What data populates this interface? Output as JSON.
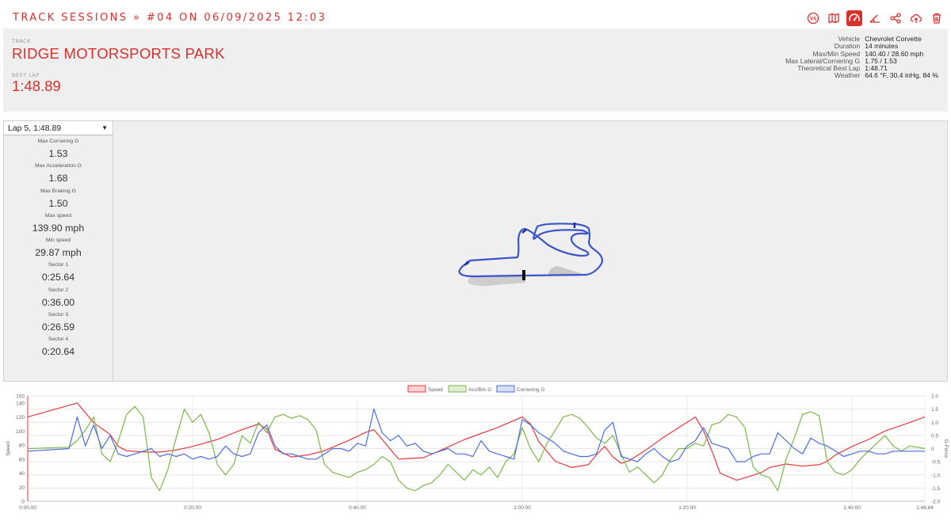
{
  "breadcrumb": "TRACK SESSIONS » #04 ON 06/09/2025 12:03",
  "actions": [
    {
      "icon": "vs-icon"
    },
    {
      "icon": "map-icon"
    },
    {
      "icon": "gauge-icon"
    },
    {
      "icon": "angle-icon"
    },
    {
      "icon": "share-icon"
    },
    {
      "icon": "cloud-upload-icon"
    },
    {
      "icon": "trash-icon"
    }
  ],
  "header": {
    "track_label": "TRACK",
    "track_name": "RIDGE MOTORSPORTS PARK",
    "best_lap_label": "BEST LAP",
    "best_lap": "1:48.89"
  },
  "stats": [
    {
      "label": "Vehicle",
      "value": "Chevrolet Corvette"
    },
    {
      "label": "Duration",
      "value": "14 minutes"
    },
    {
      "label": "Max/Min Speed",
      "value": "140.40 / 28.60 mph"
    },
    {
      "label": "Max Lateral/Cornering G",
      "value": "1.75 / 1.53"
    },
    {
      "label": "Theoretical Best Lap",
      "value": "1:48.71"
    },
    {
      "label": "Weather",
      "value": "64.6 °F, 30.4 inHg, 84 %"
    }
  ],
  "lap_select": "Lap 5, 1:48.89",
  "metrics": [
    {
      "label": "Max Cornering G",
      "value": "1.53"
    },
    {
      "label": "Max Acceleration G",
      "value": "1.68"
    },
    {
      "label": "Max Braking G",
      "value": "1.50"
    },
    {
      "label": "Max speed",
      "value": "139.90 mph"
    },
    {
      "label": "Min speed",
      "value": "29.87 mph"
    },
    {
      "label": "Sector 1",
      "value": "0:25.64"
    },
    {
      "label": "Sector 2",
      "value": "0:36.00"
    },
    {
      "label": "Sector 3",
      "value": "0:26.59"
    },
    {
      "label": "Sector 4",
      "value": "0:20.64"
    }
  ],
  "colors": {
    "accent": "#d9302c",
    "speed": "#e8373c",
    "accbrk": "#79b94a",
    "cornering": "#4a6ee0",
    "track_line": "#3a55c8"
  },
  "chart_data": {
    "type": "line",
    "legend": [
      "Speed",
      "Acc/Brk G",
      "Cornering G"
    ],
    "legend_position": "top-center",
    "x_ticks": [
      "0:00.00",
      "0:20.00",
      "0:40.00",
      "1:00.00",
      "1:20.00",
      "1:40.00",
      "1:48.84"
    ],
    "x_tick_seconds": [
      0,
      20,
      40,
      60,
      80,
      100,
      108.84
    ],
    "xlim": [
      0,
      108.84
    ],
    "ylabel_left": "Speed",
    "ylim_left": [
      0,
      150
    ],
    "y_ticks_left": [
      "0",
      "20",
      "40",
      "60",
      "80",
      "100",
      "120",
      "140",
      "150"
    ],
    "ylabel_right": "G-Force",
    "ylim_right": [
      -2.0,
      2.0
    ],
    "y_ticks_right": [
      "-2.0",
      "-1.5",
      "-1.0",
      "-0.5",
      "0",
      "0.5",
      "1.0",
      "1.5",
      "2.0"
    ],
    "grid": true,
    "series": [
      {
        "name": "Speed",
        "axis": "left",
        "x": [
          0,
          6,
          8,
          10,
          11,
          12,
          14,
          16,
          18,
          20,
          23,
          26,
          28,
          29,
          30,
          32,
          34,
          36,
          39,
          41,
          42,
          43,
          45,
          48,
          50,
          53,
          57,
          60,
          61,
          62,
          64,
          66,
          68,
          69,
          70,
          71,
          72,
          73,
          75,
          77,
          79,
          81,
          82,
          83,
          84,
          86,
          88,
          89,
          90,
          92,
          94,
          96,
          97,
          98,
          100,
          102,
          104,
          106,
          108.84
        ],
        "y": [
          120,
          140,
          112,
          95,
          78,
          72,
          70,
          70,
          73,
          78,
          88,
          102,
          110,
          103,
          74,
          63,
          66,
          72,
          87,
          98,
          102,
          88,
          60,
          62,
          72,
          88,
          105,
          120,
          110,
          85,
          57,
          48,
          52,
          66,
          78,
          63,
          54,
          58,
          73,
          90,
          105,
          120,
          100,
          72,
          40,
          30,
          37,
          41,
          48,
          53,
          50,
          52,
          57,
          66,
          78,
          88,
          100,
          108,
          120
        ]
      },
      {
        "name": "Acc/Brk G",
        "axis": "right",
        "x": [
          0,
          5,
          6,
          7,
          8,
          9,
          10,
          11,
          12,
          13,
          14,
          15,
          16,
          17,
          18,
          19,
          20,
          21,
          22,
          23,
          24,
          25,
          26,
          27,
          28,
          29,
          30,
          31,
          32,
          33,
          34,
          35,
          36,
          37,
          38,
          39,
          40,
          41,
          42,
          43,
          44,
          45,
          46,
          47,
          48,
          49,
          50,
          51,
          52,
          53,
          54,
          55,
          56,
          57,
          58,
          59,
          60,
          61,
          62,
          63,
          64,
          65,
          66,
          67,
          68,
          69,
          70,
          71,
          72,
          73,
          74,
          75,
          76,
          77,
          78,
          79,
          80,
          81,
          82,
          83,
          84,
          85,
          86,
          87,
          88,
          89,
          90,
          91,
          92,
          93,
          94,
          95,
          96,
          97,
          98,
          99,
          100,
          101,
          102,
          103,
          104,
          105,
          106,
          107,
          108.84
        ],
        "y": [
          0,
          0.05,
          0.3,
          0.7,
          1.2,
          -0.2,
          -0.5,
          0.3,
          1.3,
          1.6,
          1.2,
          -1.1,
          -1.6,
          -0.8,
          0.4,
          1.5,
          1.0,
          1.3,
          0.6,
          -0.6,
          -1.0,
          -0.6,
          0.5,
          0.2,
          1.0,
          0.6,
          1.2,
          1.3,
          1.15,
          1.25,
          1.1,
          0.7,
          -0.6,
          -0.9,
          -1.0,
          -1.1,
          -0.9,
          -0.8,
          -0.6,
          -0.3,
          -0.5,
          -1.2,
          -1.5,
          -1.6,
          -1.4,
          -1.3,
          -1.0,
          -0.6,
          -0.9,
          -1.2,
          -0.8,
          -1.0,
          -0.7,
          -1.1,
          -0.5,
          -0.2,
          0.8,
          0.0,
          -0.5,
          0.2,
          0.7,
          1.2,
          1.3,
          1.15,
          0.8,
          0.4,
          0.2,
          0.5,
          -0.2,
          -0.9,
          -0.7,
          -1.0,
          -1.3,
          -1.0,
          -0.4,
          0.0,
          0.0,
          0.2,
          0.1,
          0.9,
          1.0,
          1.3,
          1.2,
          0.8,
          -0.7,
          -1.0,
          -1.1,
          -1.6,
          -0.4,
          0.4,
          1.3,
          1.4,
          1.25,
          -0.5,
          -0.9,
          -1.0,
          -0.8,
          -0.4,
          -0.1,
          0.2,
          0.5,
          0.1,
          -0.1,
          0.1,
          0.0
        ]
      },
      {
        "name": "Cornering G",
        "axis": "right",
        "x": [
          0,
          5,
          6,
          7,
          8,
          9,
          10,
          11,
          12,
          13,
          14,
          15,
          16,
          17,
          18,
          19,
          20,
          21,
          22,
          23,
          24,
          25,
          26,
          27,
          28,
          29,
          30,
          31,
          32,
          33,
          34,
          35,
          36,
          37,
          38,
          39,
          40,
          41,
          42,
          43,
          44,
          45,
          46,
          47,
          48,
          49,
          50,
          51,
          52,
          53,
          54,
          55,
          56,
          57,
          58,
          59,
          60,
          61,
          62,
          63,
          64,
          65,
          66,
          67,
          68,
          69,
          70,
          71,
          72,
          73,
          74,
          75,
          76,
          77,
          78,
          79,
          80,
          81,
          82,
          83,
          84,
          85,
          86,
          87,
          88,
          89,
          90,
          91,
          92,
          93,
          94,
          95,
          96,
          97,
          98,
          99,
          100,
          101,
          102,
          103,
          104,
          105,
          106,
          107,
          108.84
        ],
        "y": [
          -0.1,
          0.0,
          1.2,
          0.1,
          0.9,
          0.0,
          0.5,
          -0.2,
          -0.3,
          -0.2,
          -0.1,
          0.0,
          -0.3,
          -0.2,
          -0.3,
          -0.2,
          -0.4,
          -0.3,
          -0.4,
          -0.3,
          0.1,
          -0.2,
          -0.3,
          -0.2,
          0.6,
          0.9,
          0.1,
          -0.2,
          -0.2,
          -0.3,
          -0.4,
          -0.4,
          -0.2,
          0.0,
          0.0,
          -0.1,
          0.2,
          0.1,
          1.5,
          0.6,
          0.3,
          0.5,
          0.1,
          0.2,
          -0.1,
          -0.2,
          -0.1,
          0.0,
          -0.2,
          -0.2,
          -0.3,
          0.3,
          -0.1,
          -0.2,
          -0.3,
          -0.4,
          1.1,
          0.9,
          0.6,
          0.4,
          0.2,
          -0.1,
          -0.2,
          -0.3,
          -0.3,
          -0.2,
          0.7,
          1.0,
          -0.3,
          -0.4,
          -0.5,
          -0.2,
          0.0,
          -0.3,
          -0.5,
          -0.4,
          0.1,
          0.3,
          0.8,
          0.2,
          0.1,
          0.0,
          -0.5,
          -0.5,
          -0.3,
          -0.2,
          -0.2,
          0.6,
          0.3,
          0.0,
          -0.2,
          0.4,
          0.2,
          0.1,
          -0.1,
          -0.3,
          -0.2,
          -0.1,
          -0.1,
          -0.2,
          -0.2,
          -0.1,
          -0.1,
          -0.1,
          -0.1
        ]
      }
    ]
  }
}
